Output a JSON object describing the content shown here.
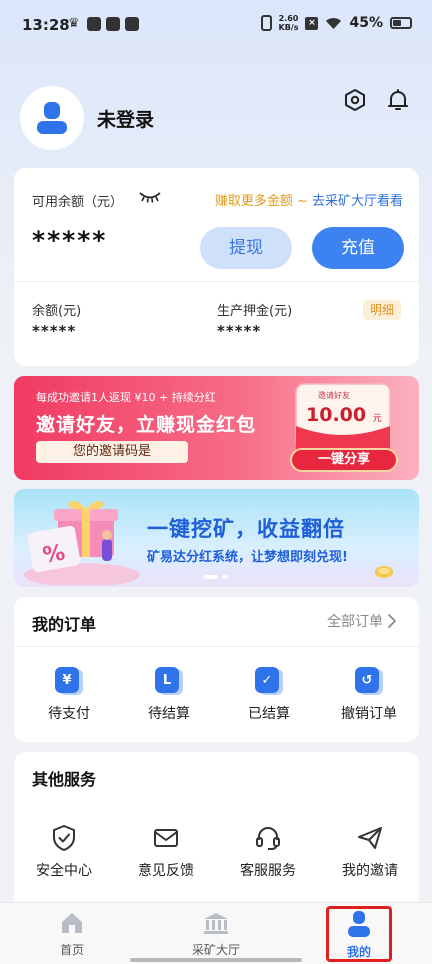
{
  "status_bar": {
    "time": "13:28",
    "net_speed_value": "2.60",
    "net_speed_unit": "KB/s",
    "battery": "45%"
  },
  "profile": {
    "username": "未登录"
  },
  "balance": {
    "available_label": "可用余额（元）",
    "earn_more": "赚取更多金额 ~ ",
    "earn_link": "去采矿大厅看看",
    "available_amount": "*****",
    "withdraw_label": "提现",
    "recharge_label": "充值",
    "balance_label": "余额(元)",
    "balance_value": "*****",
    "deposit_label": "生产押金(元)",
    "deposit_value": "*****",
    "detail_label": "明细"
  },
  "invite_banner": {
    "top_text": "每成功邀请1人返现 ¥10 + 持续分红",
    "headline": "邀请好友，立赚现金红包",
    "code_label": "您的邀请码是",
    "envelope_label": "邀请好友",
    "envelope_amount": "10.00",
    "envelope_unit": "元",
    "share_label": "一键分享"
  },
  "mining_banner": {
    "title": "一键挖矿，收益翻倍",
    "subtitle": "矿易达分红系统，让梦想即刻兑现!"
  },
  "orders": {
    "title": "我的订单",
    "all_label": "全部订单",
    "items": [
      {
        "label": "待支付",
        "glyph": "¥"
      },
      {
        "label": "待结算",
        "glyph": "L"
      },
      {
        "label": "已结算",
        "glyph": "✓"
      },
      {
        "label": "撤销订单",
        "glyph": "↺"
      }
    ]
  },
  "services": {
    "title": "其他服务",
    "items": [
      {
        "label": "安全中心",
        "icon": "shield-check-icon"
      },
      {
        "label": "意见反馈",
        "icon": "mail-icon"
      },
      {
        "label": "客服服务",
        "icon": "headset-icon"
      },
      {
        "label": "我的邀请",
        "icon": "paper-plane-icon"
      }
    ]
  },
  "bottom_nav": {
    "items": [
      {
        "label": "首页",
        "icon": "home-icon"
      },
      {
        "label": "采矿大厅",
        "icon": "bank-icon"
      },
      {
        "label": "我的",
        "icon": "user-icon"
      }
    ],
    "active": "我的"
  },
  "colors": {
    "primary": "#2f73ea",
    "accent_orange": "#e09a1b",
    "highlight": "#e02020"
  }
}
